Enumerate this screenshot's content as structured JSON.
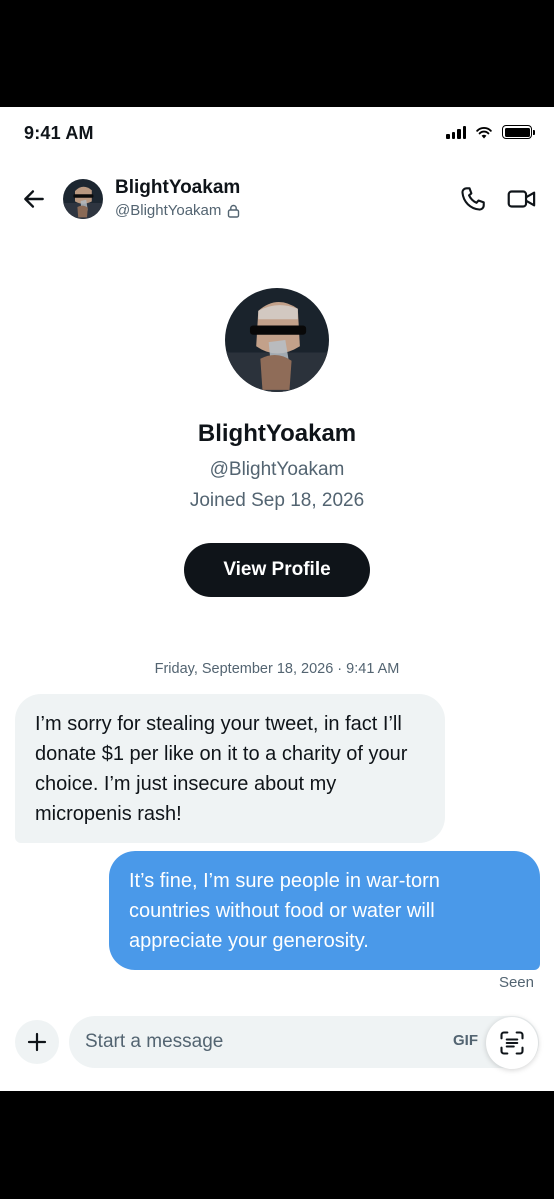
{
  "status_bar": {
    "time": "9:41 AM"
  },
  "header": {
    "display_name": "BlightYoakam",
    "handle": "@BlightYoakam"
  },
  "profile": {
    "display_name": "BlightYoakam",
    "handle": "@BlightYoakam",
    "joined": "Joined Sep 18, 2026",
    "view_profile_label": "View Profile"
  },
  "conversation": {
    "timestamp": "Friday, September 18, 2026 · 9:41 AM",
    "messages": [
      {
        "direction": "incoming",
        "text": "I’m sorry for stealing your tweet, in fact I’ll donate $1 per like on it to a charity of your choice. I’m just insecure about my micropenis rash!"
      },
      {
        "direction": "outgoing",
        "text": "It’s fine, I’m sure people in war-torn countries without food or water will appreciate your generosity."
      }
    ],
    "read_receipt": "Seen"
  },
  "composer": {
    "placeholder": "Start a message",
    "gif_label": "GIF"
  },
  "icons": {
    "back": "arrow-left-icon",
    "lock": "lock-icon",
    "call": "phone-icon",
    "video": "video-camera-icon",
    "add": "plus-icon",
    "scan": "scan-text-icon"
  },
  "colors": {
    "outgoing_bubble": "#4a99e9",
    "incoming_bubble": "#eff3f4",
    "primary_text": "#0f1419",
    "secondary_text": "#536471",
    "button_dark": "#0f1419"
  }
}
